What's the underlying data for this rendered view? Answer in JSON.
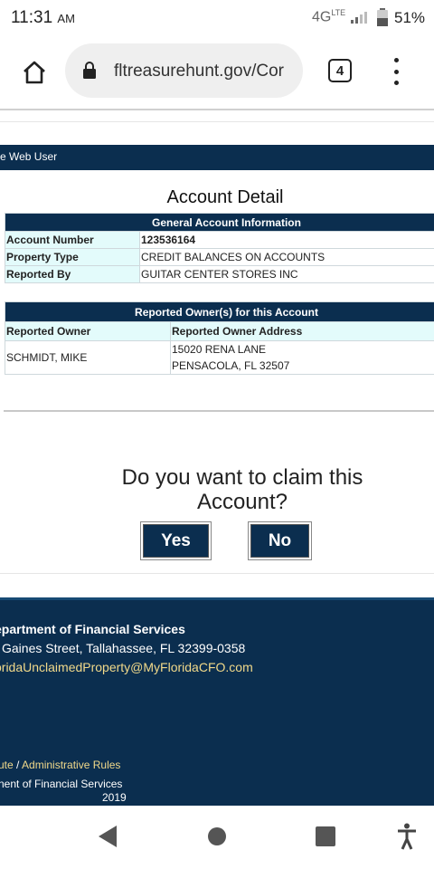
{
  "status_bar": {
    "time": "11:31",
    "ampm": "AM",
    "network": "4G",
    "network_sup": "LTE",
    "battery_percent": "51%",
    "icons": [
      "signal-icon",
      "battery-icon"
    ]
  },
  "browser": {
    "url": "fltreasurehunt.gov/Cor",
    "tab_count": "4",
    "icons": [
      "home-icon",
      "lock-icon",
      "menu-icon"
    ]
  },
  "page": {
    "user_bar": "e Web User",
    "title": "Account Detail",
    "general": {
      "header": "General Account Information",
      "rows": [
        {
          "label": "Account Number",
          "value": "123536164"
        },
        {
          "label": "Property Type",
          "value": "CREDIT BALANCES ON ACCOUNTS"
        },
        {
          "label": "Reported By",
          "value": "GUITAR CENTER STORES INC"
        }
      ]
    },
    "owners": {
      "header": "Reported Owner(s) for this Account",
      "col_owner": "Reported Owner",
      "col_address": "Reported Owner Address",
      "rows": [
        {
          "owner": "SCHMIDT, MIKE",
          "address_line1": "15020 RENA LANE",
          "address_line2": "PENSACOLA, FL 32507"
        }
      ]
    },
    "claim": {
      "question": "Do you want to claim this Account?",
      "yes": "Yes",
      "no": "No"
    }
  },
  "footer": {
    "org": "epartment of Financial Services",
    "address": "Gaines Street, Tallahassee, FL 32399-0358",
    "email": "oridaUnclaimedProperty@MyFloridaCFO.com",
    "links_prefix": "ute",
    "links_sep": " / ",
    "links_admin": "Administrative Rules",
    "copyright": "nent of Financial Services",
    "year": "2019"
  },
  "navbar": {
    "icons": [
      "back-icon",
      "home-circle-icon",
      "recents-icon",
      "accessibility-icon"
    ]
  },
  "colors": {
    "navy": "#0b2e4f",
    "label_bg": "#e3fbfb",
    "link_gold": "#f1d98a"
  }
}
